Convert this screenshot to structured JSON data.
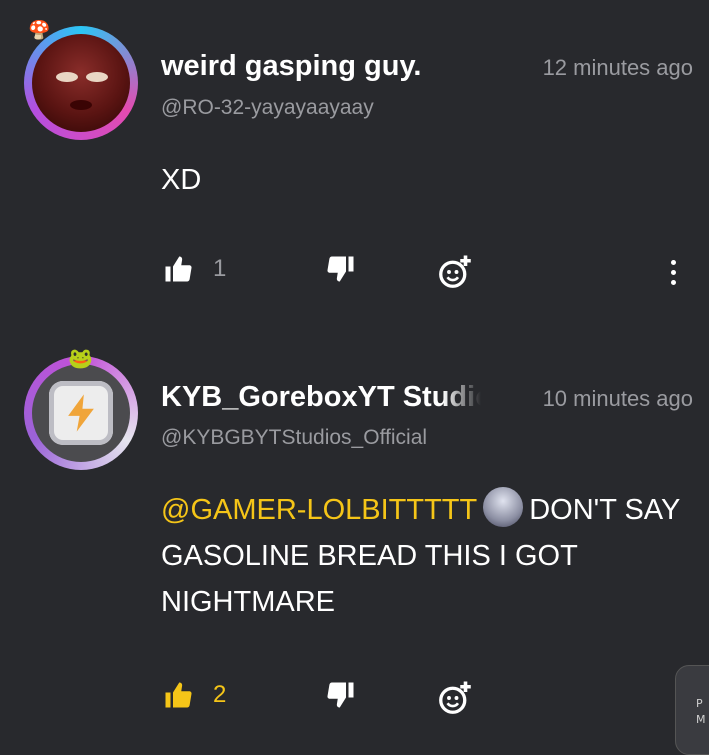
{
  "comments": [
    {
      "name": "weird gasping guy.",
      "handle": "@RO-32-yayayaayaay",
      "time": "12 minutes ago",
      "text": "XD",
      "likes": "1",
      "liked": false
    },
    {
      "name": "KYB_GoreboxYT Studios",
      "handle": "@KYBGBYTStudios_Official",
      "time": "10 minutes ago",
      "mention": "@GAMER-LOLBITTTTT",
      "text_after_mention": "DON'T SAY GASOLINE BREAD THIS I GOT NIGHTMARE",
      "likes": "2",
      "liked": true
    }
  ],
  "icons": {
    "like": "thumbs-up-icon",
    "dislike": "thumbs-down-icon",
    "react": "add-reaction-icon",
    "more": "more-vertical-icon"
  },
  "colors": {
    "background": "#28292d",
    "accent": "#f5c518",
    "secondary_text": "#9a9ba0"
  },
  "corner_card_text": "P\nM"
}
